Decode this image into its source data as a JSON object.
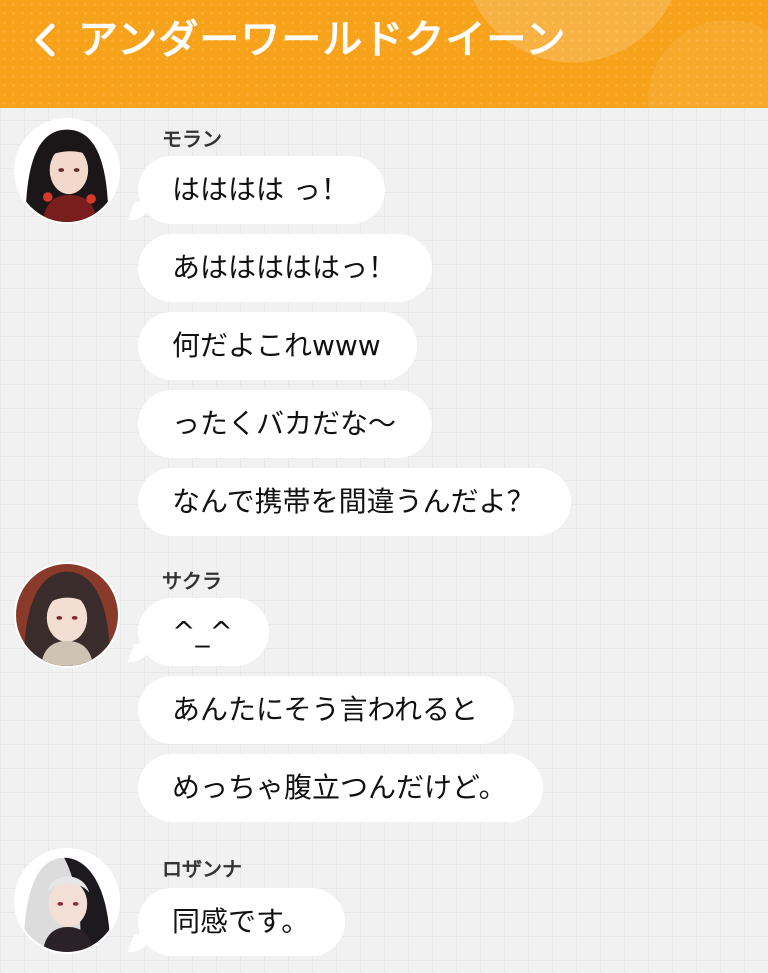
{
  "header": {
    "back_icon": "chevron-left-icon",
    "title": "アンダーワールドクイーン",
    "background_color": "#f7a21b"
  },
  "chat": {
    "groups": [
      {
        "sender": "モラン",
        "avatar": "avatar-moran",
        "messages": [
          "はははは っ！",
          "あはははははっ！",
          "何だよこれwww",
          "ったくバカだな～",
          "なんで携帯を間違うんだよ？"
        ]
      },
      {
        "sender": "サクラ",
        "avatar": "avatar-sakura",
        "messages": [
          "^_^",
          "あんたにそう言われると",
          "めっちゃ腹立つんだけど。"
        ]
      },
      {
        "sender": "ロザンナ",
        "avatar": "avatar-rosanna",
        "messages": [
          "同感です。"
        ]
      }
    ]
  }
}
